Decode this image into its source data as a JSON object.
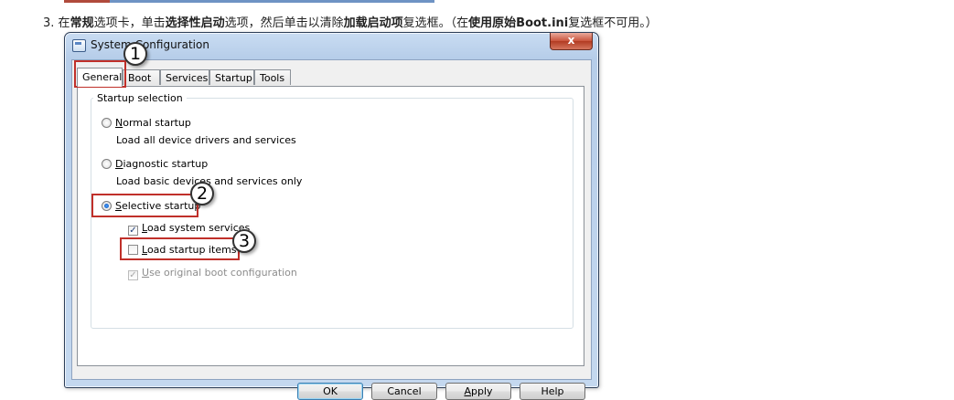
{
  "instruction": {
    "number": "3.",
    "parts": [
      "在",
      "常规",
      "选项卡，单击",
      "选择性启动",
      "选项，然后单击以清除",
      "加载启动项",
      "复选框。（在",
      "使用原始Boot.ini",
      "复选框不可用。）"
    ]
  },
  "window": {
    "title": "System Configuration",
    "close_glyph": "x"
  },
  "tabs": [
    "General",
    "Boot",
    "Services",
    "Startup",
    "Tools"
  ],
  "startup_selection": {
    "legend": "Startup selection",
    "normal": {
      "label_mnemonic": "N",
      "label_rest": "ormal startup",
      "description": "Load all device drivers and services",
      "selected": false
    },
    "diagnostic": {
      "label_mnemonic": "D",
      "label_rest": "iagnostic startup",
      "description": "Load basic devices and services only",
      "selected": false
    },
    "selective": {
      "label_mnemonic": "S",
      "label_rest": "elective startup",
      "selected": true
    },
    "load_system_services": {
      "label_mnemonic": "L",
      "label_rest": "oad system services",
      "checked": true
    },
    "load_startup_items": {
      "label_mnemonic": "L",
      "label_rest": "oad startup items",
      "checked": false
    },
    "use_original_boot": {
      "label_mnemonic": "U",
      "label_rest": "se original boot configuration",
      "checked": true,
      "disabled": true
    }
  },
  "buttons": {
    "ok": "OK",
    "cancel": "Cancel",
    "apply_mnemonic": "A",
    "apply_rest": "pply",
    "help": "Help"
  },
  "callouts": [
    "1",
    "2",
    "3"
  ],
  "colors": {
    "highlight_box": "#c0302a",
    "window_frame": "#b6cde9",
    "radio_dot": "#0a4fb3"
  }
}
